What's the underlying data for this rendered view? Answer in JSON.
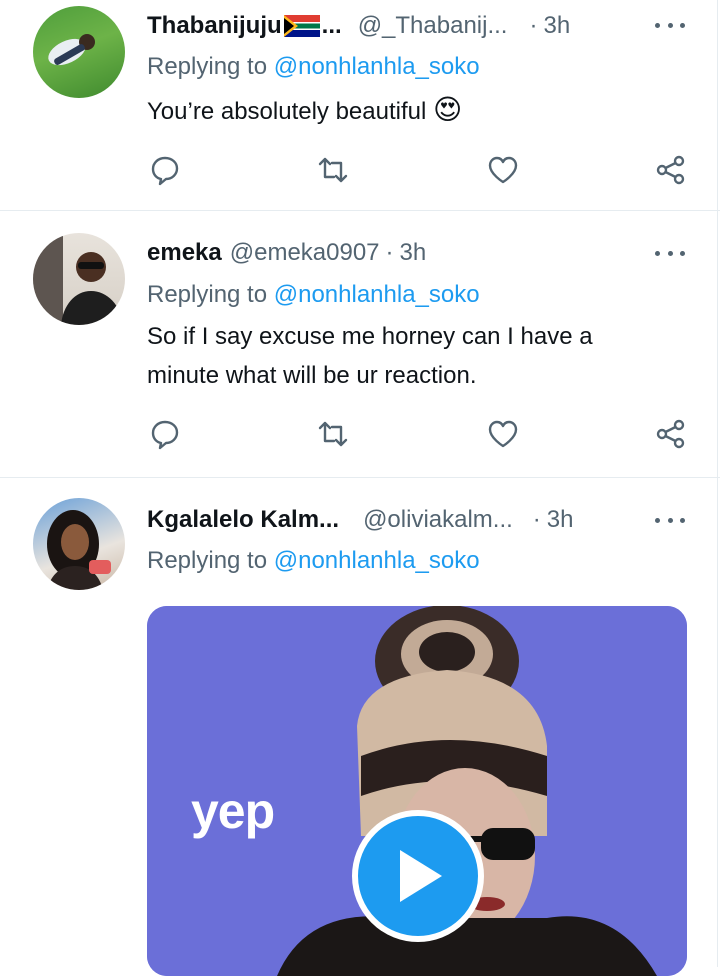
{
  "tweets": [
    {
      "name": "Thabanijuju",
      "flag": "south-africa-flag-emoji",
      "name_ellipsis": "...",
      "handle": "@_Thabanij...",
      "dot": "·",
      "time": "3h",
      "replying_to_label": "Replying to",
      "replying_to_mention": "@nonhlanhla_soko",
      "text": "You’re absolutely beautiful",
      "emoji": "😍"
    },
    {
      "name": "emeka",
      "handle": "@emeka0907",
      "dot": "·",
      "time": "3h",
      "replying_to_label": "Replying to",
      "replying_to_mention": "@nonhlanhla_soko",
      "text_line1": "So if I say excuse me horney can I have a",
      "text_line2": "minute what will be ur reaction."
    },
    {
      "name": "Kgalalelo Kalm...",
      "handle": "@oliviakalm...",
      "dot": "·",
      "time": "3h",
      "replying_to_label": "Replying to",
      "replying_to_mention": "@nonhlanhla_soko",
      "media_caption": "yep"
    }
  ],
  "icons": {
    "reply": "reply-icon",
    "retweet": "retweet-icon",
    "like": "like-icon",
    "share": "share-icon",
    "more": "more-icon",
    "play": "play-icon"
  },
  "colors": {
    "link": "#1d9bf0",
    "secondary_text": "#536471",
    "media_bg": "#6b6fd8"
  }
}
